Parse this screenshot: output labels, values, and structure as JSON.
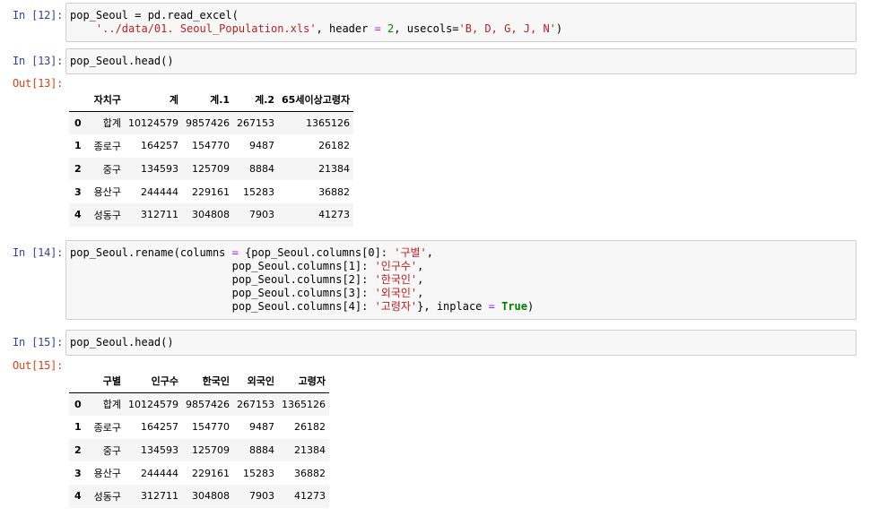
{
  "cells": [
    {
      "in_prompt": "In [12]:",
      "code_line1": "pop_Seoul = pd.read_excel(",
      "code_line2_path": "'../data/01. Seoul_Population.xls'",
      "code_line2_header": ", header ",
      "code_line2_hval": "2",
      "code_line2_usecols": ", usecols=",
      "code_line2_cols": "'B, D, G, J, N'",
      "code_line2_end": ")"
    },
    {
      "in_prompt": "In [13]:",
      "code": "pop_Seoul.head()",
      "out_prompt": "Out[13]:",
      "columns": [
        "",
        "자치구",
        "계",
        "계.1",
        "계.2",
        "65세이상고령자"
      ],
      "rows": [
        [
          "0",
          "합계",
          "10124579",
          "9857426",
          "267153",
          "1365126"
        ],
        [
          "1",
          "종로구",
          "164257",
          "154770",
          "9487",
          "26182"
        ],
        [
          "2",
          "중구",
          "134593",
          "125709",
          "8884",
          "21384"
        ],
        [
          "3",
          "용산구",
          "244444",
          "229161",
          "15283",
          "36882"
        ],
        [
          "4",
          "성동구",
          "312711",
          "304808",
          "7903",
          "41273"
        ]
      ]
    },
    {
      "in_prompt": "In [14]:",
      "l1_a": "pop_Seoul.rename(columns ",
      "l1_b": " {pop_Seoul.columns[0]: ",
      "l1_s": "'구별'",
      "l2_a": "pop_Seoul.columns[1]: ",
      "l2_s": "'인구수'",
      "l3_a": "pop_Seoul.columns[2]: ",
      "l3_s": "'한국인'",
      "l4_a": "pop_Seoul.columns[3]: ",
      "l4_s": "'외국인'",
      "l5_a": "pop_Seoul.columns[4]: ",
      "l5_s": "'고령자'",
      "l5_b": "}, inplace ",
      "l5_kw": "True",
      "l5_end": ")"
    },
    {
      "in_prompt": "In [15]:",
      "code": "pop_Seoul.head()",
      "out_prompt": "Out[15]:",
      "columns": [
        "",
        "구별",
        "인구수",
        "한국인",
        "외국인",
        "고령자"
      ],
      "rows": [
        [
          "0",
          "합계",
          "10124579",
          "9857426",
          "267153",
          "1365126"
        ],
        [
          "1",
          "종로구",
          "164257",
          "154770",
          "9487",
          "26182"
        ],
        [
          "2",
          "중구",
          "134593",
          "125709",
          "8884",
          "21384"
        ],
        [
          "3",
          "용산구",
          "244444",
          "229161",
          "15283",
          "36882"
        ],
        [
          "4",
          "성동구",
          "312711",
          "304808",
          "7903",
          "41273"
        ]
      ]
    }
  ],
  "ops": {
    "eq": "=",
    "comma": ","
  }
}
